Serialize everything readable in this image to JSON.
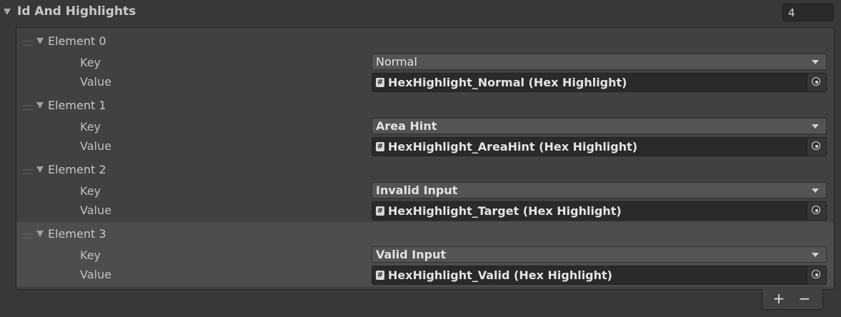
{
  "header": {
    "title": "Id And Highlights",
    "size": "4"
  },
  "labels": {
    "key": "Key",
    "value": "Value"
  },
  "elements": [
    {
      "label": "Element 0",
      "key": "Normal",
      "value": "HexHighlight_Normal (Hex Highlight)",
      "key_bold": false,
      "selected": false
    },
    {
      "label": "Element 1",
      "key": "Area Hint",
      "value": "HexHighlight_AreaHint (Hex Highlight)",
      "key_bold": true,
      "selected": false
    },
    {
      "label": "Element 2",
      "key": "Invalid Input",
      "value": "HexHighlight_Target (Hex Highlight)",
      "key_bold": true,
      "selected": false
    },
    {
      "label": "Element 3",
      "key": "Valid Input",
      "value": "HexHighlight_Valid (Hex Highlight)",
      "key_bold": true,
      "selected": true
    }
  ],
  "footer": {
    "plus": "+",
    "minus": "−"
  },
  "icons": {
    "foldout": "triangle-down-icon",
    "handle": "drag-handle-icon",
    "dropdown": "chevron-down-icon",
    "script": "script-hash-icon",
    "picker": "object-picker-icon"
  },
  "colors": {
    "background": "#383838",
    "list_background": "#414141",
    "selected_row": "#4d4d4d",
    "field_dark": "#2a2a2a",
    "dropdown_bg": "#545454"
  }
}
